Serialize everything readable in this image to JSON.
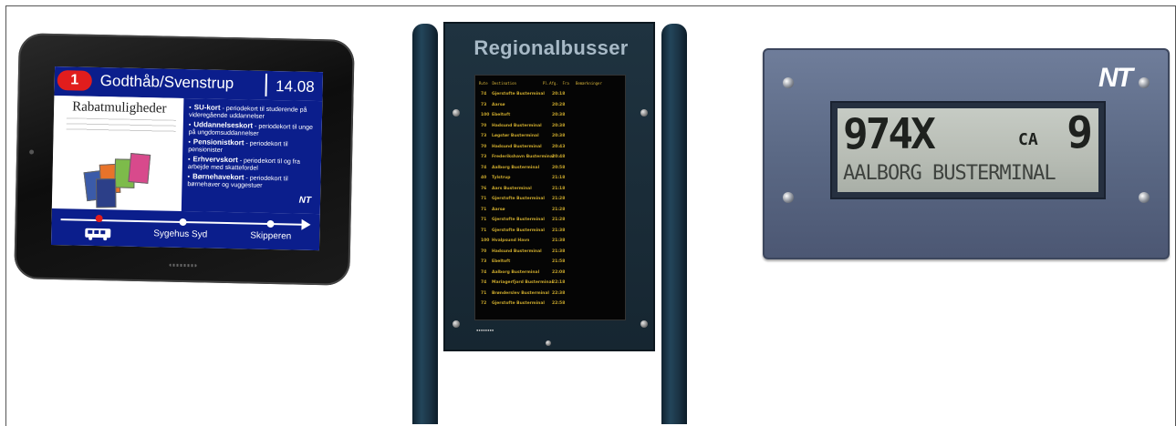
{
  "tablet": {
    "route_number": "1",
    "route_name": "Godthåb/Svenstrup",
    "time": "14.08",
    "ad_title": "Rabatmuligheder",
    "bullets": [
      {
        "title": "SU-kort",
        "text": "- periodekort til studerende på videregående uddannelser"
      },
      {
        "title": "Uddannelseskort",
        "text": "- periodekort til unge på ungdomsuddannelser"
      },
      {
        "title": "Pensionistkort",
        "text": "- periodekort til pensionister"
      },
      {
        "title": "Erhvervskort",
        "text": "- periodekort til og fra arbejde med skattefordel"
      },
      {
        "title": "Børnehavekort",
        "text": "- periodekort til børnehaver og vuggestuer"
      }
    ],
    "brand": "NT",
    "stops": [
      "Sygehus Syd",
      "Skipperen"
    ],
    "colors": {
      "header": "#0b1e8c",
      "route_badge": "#e11d1d"
    }
  },
  "board": {
    "title": "Regionalbusser",
    "rows": [
      {
        "route": "74",
        "dest": "Gjerstofte Busterminal",
        "time": "20:18"
      },
      {
        "route": "73",
        "dest": "Aarsø",
        "time": "20:28"
      },
      {
        "route": "100",
        "dest": "Ebeltoft",
        "time": "20:38"
      },
      {
        "route": "70",
        "dest": "Hadsund Busterminal",
        "time": "20:38"
      },
      {
        "route": "73",
        "dest": "Løgstør Busterminal",
        "time": "20:38"
      },
      {
        "route": "70",
        "dest": "Hadsund Busterminal",
        "time": "20:43"
      },
      {
        "route": "73",
        "dest": "Frederikshavn Busterminal",
        "time": "20:48"
      },
      {
        "route": "74",
        "dest": "Aalborg Busterminal",
        "time": "20:58"
      },
      {
        "route": "40",
        "dest": "Tylstrup",
        "time": "21:18"
      },
      {
        "route": "76",
        "dest": "Aars Busterminal",
        "time": "21:18"
      },
      {
        "route": "71",
        "dest": "Gjerstofte Busterminal",
        "time": "21:28"
      },
      {
        "route": "71",
        "dest": "Aarsø",
        "time": "21:28"
      },
      {
        "route": "71",
        "dest": "Gjerstofte Busterminal",
        "time": "21:28"
      },
      {
        "route": "71",
        "dest": "Gjerstofte Busterminal",
        "time": "21:38"
      },
      {
        "route": "100",
        "dest": "Hvalpsund Havn",
        "time": "21:38"
      },
      {
        "route": "70",
        "dest": "Hadsund Busterminal",
        "time": "21:38"
      },
      {
        "route": "73",
        "dest": "Ebeltoft",
        "time": "21:58"
      },
      {
        "route": "74",
        "dest": "Aalborg Busterminal",
        "time": "22:08"
      },
      {
        "route": "74",
        "dest": "Mariagerfjord Busterminal",
        "time": "22:18"
      },
      {
        "route": "71",
        "dest": "Brønderslev Busterminal",
        "time": "22:38"
      },
      {
        "route": "72",
        "dest": "Gjerstofte Busterminal",
        "time": "22:58"
      }
    ],
    "colors": {
      "text": "#c9a72c"
    }
  },
  "nt_display": {
    "brand": "NT",
    "route": "974X",
    "approx": "CA",
    "minutes": "9",
    "destination": "AALBORG BUSTERMINAL"
  }
}
